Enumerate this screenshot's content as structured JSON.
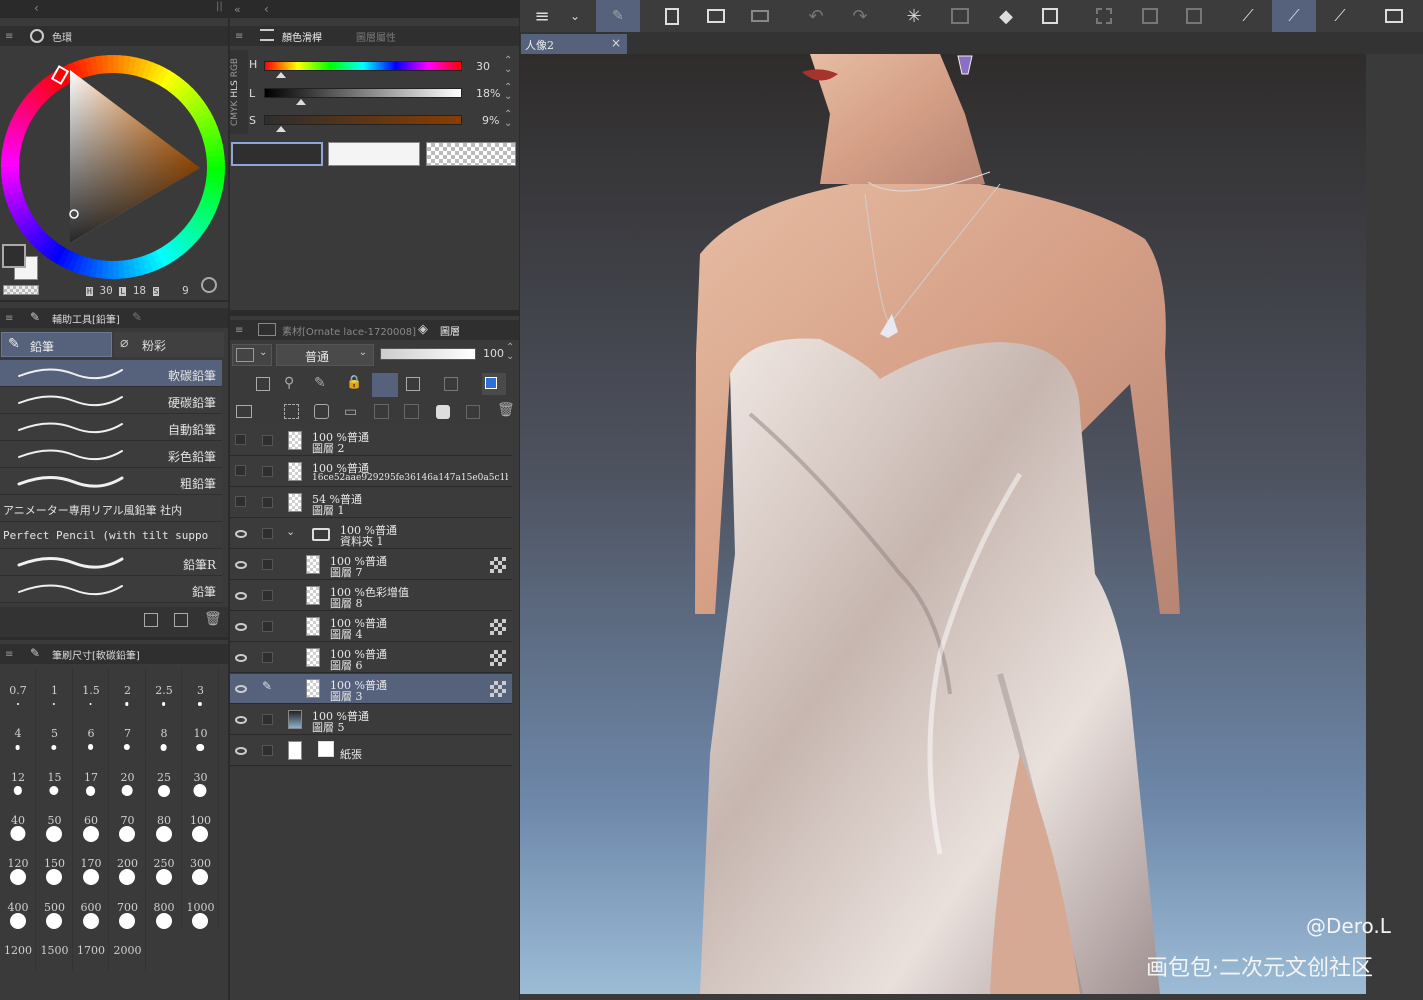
{
  "color_wheel_panel": {
    "tab_label": "色環",
    "readout": {
      "h": "30",
      "l": "18",
      "s": "9"
    },
    "colors": {
      "main": "#2f2f2f",
      "sub": "#f4f4f4",
      "hue": "#ff7a00"
    }
  },
  "color_slider_panel": {
    "tabs": [
      "顏色滑桿",
      "圖層屬性"
    ],
    "modes": [
      "RGB",
      "HLS",
      "CMYK"
    ],
    "sliders": [
      {
        "label": "H",
        "value": "30"
      },
      {
        "label": "L",
        "value": "18%"
      },
      {
        "label": "S",
        "value": "9%"
      }
    ]
  },
  "subtool_panel": {
    "tab_label": "輔助工具[鉛筆]",
    "groups": [
      "鉛筆",
      "粉彩"
    ],
    "brushes": [
      "軟碳鉛筆",
      "硬碳鉛筆",
      "自動鉛筆",
      "彩色鉛筆",
      "粗鉛筆",
      "アニメーター専用リアル風鉛筆 社内",
      "Perfect Pencil (with tilt suppo",
      "鉛筆R",
      "鉛筆"
    ]
  },
  "brush_size_panel": {
    "tab_label": "筆刷尺寸[軟碳鉛筆]",
    "sizes": [
      "0.7",
      "1",
      "1.5",
      "2",
      "2.5",
      "3",
      "4",
      "5",
      "6",
      "7",
      "8",
      "10",
      "12",
      "15",
      "17",
      "20",
      "25",
      "30",
      "40",
      "50",
      "60",
      "70",
      "80",
      "100",
      "120",
      "150",
      "170",
      "200",
      "250",
      "300",
      "400",
      "500",
      "600",
      "700",
      "800",
      "1000",
      "1200",
      "1500",
      "1700",
      "2000"
    ]
  },
  "layer_panel": {
    "tabs": [
      "素材[Ornate lace-1720008]",
      "圖層"
    ],
    "blend_mode": "普通",
    "opacity": "100",
    "layers": [
      {
        "line1": "100 %普通",
        "line2": "圖層 2",
        "indent": 0,
        "eye": false,
        "selected": false,
        "mark": false
      },
      {
        "line1": "100 %普通",
        "line2": "16ce52aae929295fe36146a147a15e0a5c1b23",
        "indent": 0,
        "eye": false,
        "selected": false,
        "mark": false
      },
      {
        "line1": "54 %普通",
        "line2": "圖層 1",
        "indent": 0,
        "eye": false,
        "selected": false,
        "mark": false
      },
      {
        "line1": "100 %普通",
        "line2": "資料夾 1",
        "indent": 0,
        "eye": true,
        "selected": false,
        "mark": false,
        "folder": true
      },
      {
        "line1": "100 %普通",
        "line2": "圖層 7",
        "indent": 1,
        "eye": true,
        "selected": false,
        "mark": true
      },
      {
        "line1": "100 %色彩增值",
        "line2": "圖層 8",
        "indent": 1,
        "eye": true,
        "selected": false,
        "mark": false
      },
      {
        "line1": "100 %普通",
        "line2": "圖層 4",
        "indent": 1,
        "eye": true,
        "selected": false,
        "mark": true
      },
      {
        "line1": "100 %普通",
        "line2": "圖層 6",
        "indent": 1,
        "eye": true,
        "selected": false,
        "mark": true
      },
      {
        "line1": "100 %普通",
        "line2": "圖層 3",
        "indent": 1,
        "eye": true,
        "selected": true,
        "mark": true
      },
      {
        "line1": "100 %普通",
        "line2": "圖層 5",
        "indent": 0,
        "eye": true,
        "selected": false,
        "mark": false
      },
      {
        "line1": "",
        "line2": "紙張",
        "indent": 0,
        "eye": true,
        "selected": false,
        "mark": false,
        "paper": true
      }
    ]
  },
  "canvas": {
    "doc_tab": "人像2",
    "watermark_1": "@Dero.L",
    "watermark_2": "画包包·二次元文创社区"
  }
}
